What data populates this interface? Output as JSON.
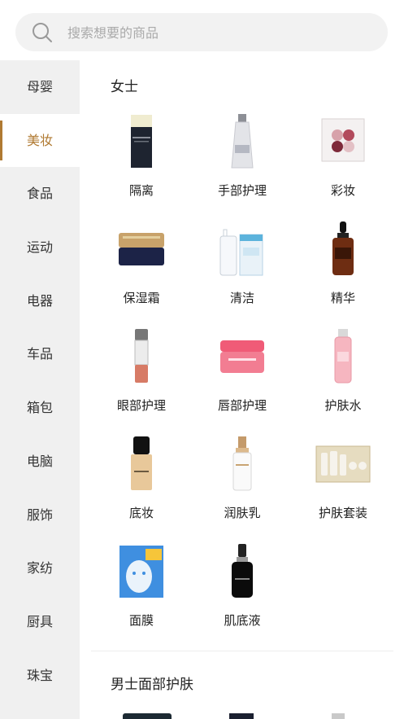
{
  "search": {
    "placeholder": "搜索想要的商品",
    "value": ""
  },
  "sidebar": {
    "items": [
      {
        "label": "母婴"
      },
      {
        "label": "美妆",
        "active": true
      },
      {
        "label": "食品"
      },
      {
        "label": "运动"
      },
      {
        "label": "电器"
      },
      {
        "label": "车品"
      },
      {
        "label": "箱包"
      },
      {
        "label": "电脑"
      },
      {
        "label": "服饰"
      },
      {
        "label": "家纺"
      },
      {
        "label": "厨具"
      },
      {
        "label": "珠宝"
      }
    ]
  },
  "colors": {
    "accent": "#b07a32",
    "sidebar_bg": "#f0f0f0"
  },
  "sections": [
    {
      "title": "女士",
      "items": [
        {
          "label": "隔离",
          "icon": "primer-bottle-icon"
        },
        {
          "label": "手部护理",
          "icon": "hand-cream-tube-icon"
        },
        {
          "label": "彩妆",
          "icon": "eyeshadow-palette-icon"
        },
        {
          "label": "保湿霜",
          "icon": "cream-jar-icon"
        },
        {
          "label": "清洁",
          "icon": "cleanser-set-icon"
        },
        {
          "label": "精华",
          "icon": "serum-bottle-icon"
        },
        {
          "label": "眼部护理",
          "icon": "eye-serum-icon"
        },
        {
          "label": "唇部护理",
          "icon": "lip-mask-jar-icon"
        },
        {
          "label": "护肤水",
          "icon": "toner-bottle-icon"
        },
        {
          "label": "底妆",
          "icon": "foundation-bottle-icon"
        },
        {
          "label": "润肤乳",
          "icon": "lotion-bottle-icon"
        },
        {
          "label": "护肤套装",
          "icon": "skincare-set-icon"
        },
        {
          "label": "面膜",
          "icon": "face-mask-pack-icon"
        },
        {
          "label": "肌底液",
          "icon": "essence-bottle-icon"
        }
      ]
    },
    {
      "title": "男士面部护肤"
    }
  ]
}
